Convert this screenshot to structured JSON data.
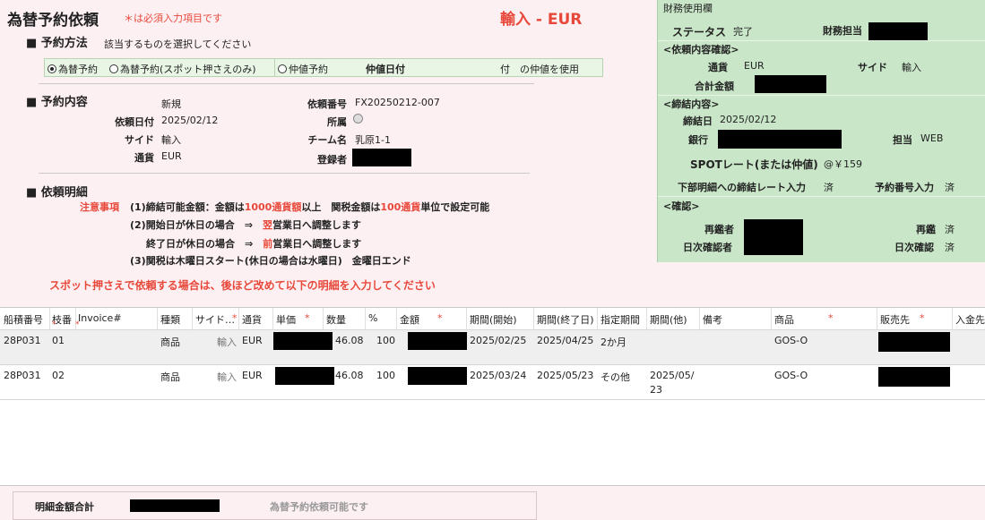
{
  "header": {
    "title": "為替予約依頼",
    "required_note": "＊は必須入力項目です",
    "direction_currency": "輸入 - EUR"
  },
  "method": {
    "heading": "■ 予約方法",
    "hint": "該当するものを選択してください",
    "options": [
      "為替予約",
      "為替予約(スポット押さえのみ)",
      "仲値予約"
    ],
    "selected_index": 0,
    "nakane_label": "仲値日付",
    "nakane_suffix": "付　の仲値を使用"
  },
  "content": {
    "heading": "■ 予約内容",
    "status_value": "新規",
    "request_no_label": "依頼番号",
    "request_no": "FX20250212-007",
    "request_date_label": "依頼日付",
    "request_date": "2025/02/12",
    "affiliation_label": "所属",
    "side_label": "サイド",
    "side": "輸入",
    "team_label": "チーム名",
    "team": "乳原1-1",
    "currency_label": "通貨",
    "currency": "EUR",
    "registrant_label": "登録者"
  },
  "details": {
    "heading": "■ 依頼明細",
    "notice_label": "注意事項",
    "note1_a": "(1)締結可能金額：金額は",
    "note1_b": "1000通貨額",
    "note1_c": "以上　関税金額は",
    "note1_d": "100通貨",
    "note1_e": "単位で設定可能",
    "note2_a": "(2)開始日が休日の場合　⇒　",
    "note2_b": "翌",
    "note2_c": "営業日へ調整します",
    "note3_a": "終了日が休日の場合　⇒　",
    "note3_b": "前",
    "note3_c": "営業日へ調整します",
    "note4": "(3)関税は木曜日スタート(休日の場合は水曜日)　金曜日エンド",
    "spot_note": "スポット押さえで依頼する場合は、後ほど改めて以下の明細を入力してください"
  },
  "panel": {
    "title": "財務使用欄",
    "status_label": "ステータス",
    "status": "完了",
    "finance_label": "財務担当",
    "confirm_heading": "<依頼内容確認>",
    "currency_label": "通貨",
    "currency": "EUR",
    "side_label": "サイド",
    "side": "輸入",
    "total_label": "合計金額",
    "contract_heading": "<締結内容>",
    "contract_date_label": "締結日",
    "contract_date": "2025/02/12",
    "bank_label": "銀行",
    "charge_label": "担当",
    "charge": "WEB",
    "spot_label": "SPOTレート(または仲値)",
    "spot_value": "@￥159",
    "rate_input_label": "下部明細への締結レート入力",
    "rate_input": "済",
    "resv_no_label": "予約番号入力",
    "resv_no": "済",
    "check_heading": "<確認>",
    "reviewer_label": "再鑑者",
    "review_label": "再鑑",
    "review": "済",
    "daily_checker_label": "日次確認者",
    "daily_check_label": "日次確認",
    "daily_check": "済"
  },
  "grid": {
    "columns": [
      "船積番号",
      "枝番",
      "Invoice#",
      "種類",
      "サイド…",
      "通貨",
      "単価",
      "数量",
      "%",
      "金額",
      "期間(開始)",
      "期間(終了日)",
      "指定期間",
      "期間(他)",
      "備考",
      "商品",
      "販売先",
      "入金先/"
    ],
    "rows": [
      {
        "ship": "28P031",
        "branch": "01",
        "invoice": "",
        "kind": "商品",
        "side": "輸入",
        "currency": "EUR",
        "qty": "46.08",
        "pct": "100",
        "start": "2025/02/25",
        "end": "2025/04/25",
        "period": "2か月",
        "other": "",
        "note": "",
        "product": "GOS-O"
      },
      {
        "ship": "28P031",
        "branch": "02",
        "invoice": "",
        "kind": "商品",
        "side": "輸入",
        "currency": "EUR",
        "qty": "46.08",
        "pct": "100",
        "start": "2025/03/24",
        "end": "2025/05/23",
        "period": "その他",
        "other": "2025/05/",
        "other2": "23",
        "note": "",
        "product": "GOS-O"
      }
    ]
  },
  "footer": {
    "total_label": "明細金額合計",
    "status_text": "為替予約依頼可能です"
  }
}
